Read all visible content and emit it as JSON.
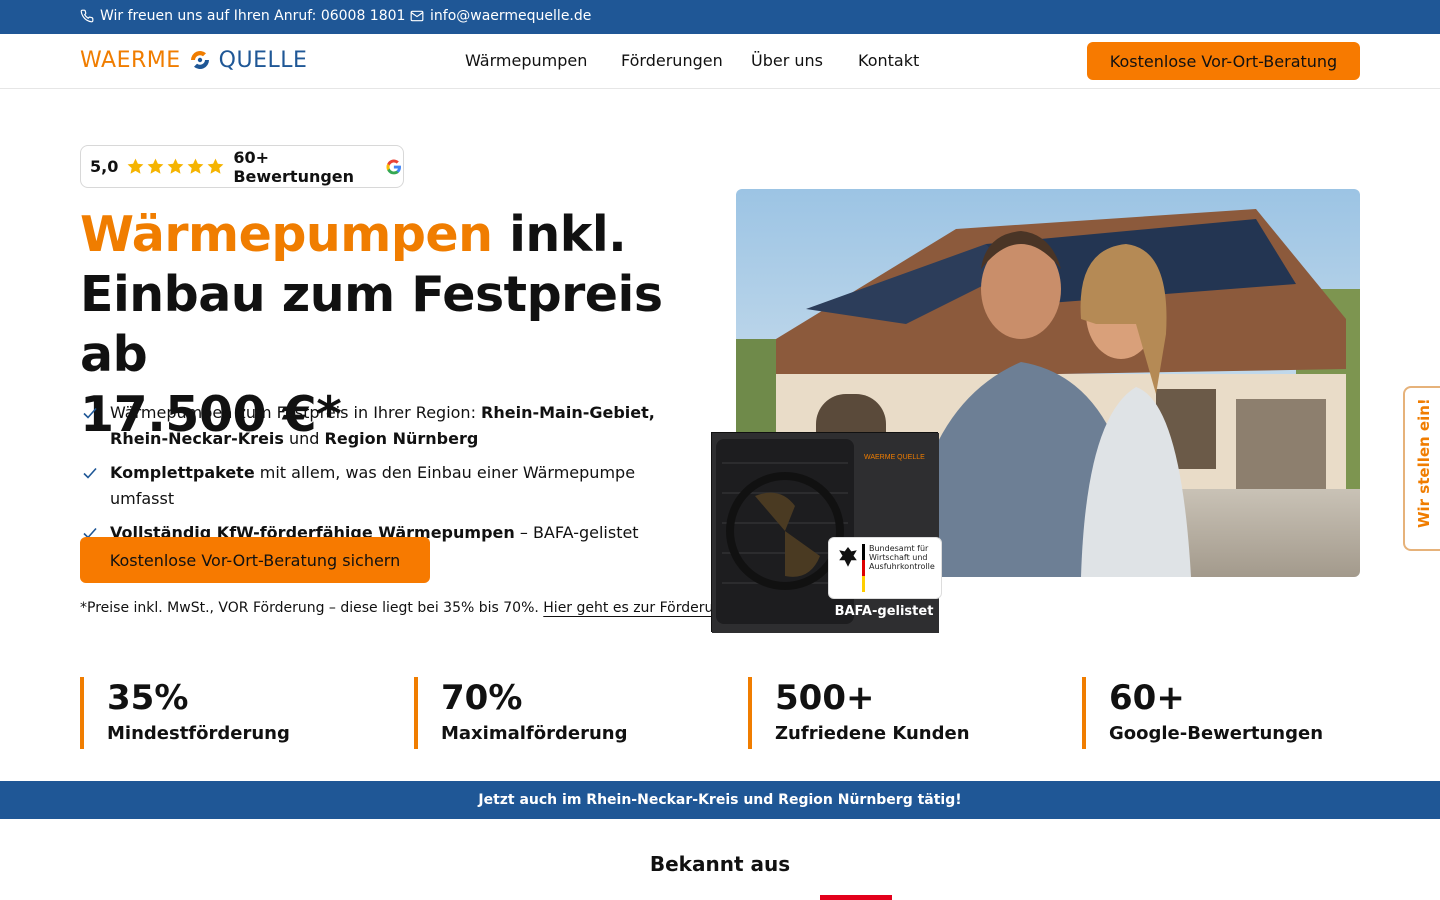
{
  "topbar": {
    "phone_text": "Wir freuen uns auf Ihren Anruf: 06008 1801",
    "email_text": "info@waermequelle.de"
  },
  "nav": {
    "logo_left": "WAERME",
    "logo_right": "QUELLE",
    "items": [
      "Wärmepumpen",
      "Förderungen",
      "Über uns",
      "Kontakt"
    ],
    "cta": "Kostenlose Vor-Ort-Beratung"
  },
  "rating": {
    "score": "5,0",
    "stars": 5,
    "reviews": "60+ Bewertungen"
  },
  "headline": {
    "orange": "Wärmepumpen",
    "rest1": " inkl.",
    "line2": "Einbau zum Festpreis ab",
    "line3": "17.500 €*"
  },
  "checks": [
    {
      "a": "Wärmepumpen zum Festpreis in Ihrer Region: ",
      "b": "Rhein-Main-Gebiet, Rhein-Neckar-Kreis",
      "c": " und ",
      "d": "Region Nürnberg"
    },
    {
      "a": "",
      "b": "Komplettpakete",
      "c": " mit allem, was den Einbau einer Wärmepumpe umfasst",
      "d": ""
    },
    {
      "a": "",
      "b": "Vollständig KfW-förderfähige Wärmepumpen",
      "c": " – BAFA-gelistet",
      "d": ""
    }
  ],
  "cta_main": "Kostenlose Vor-Ort-Beratung sichern",
  "note": {
    "text": "*Preise inkl. MwSt., VOR Förderung – diese liegt bei 35% bis 70%. ",
    "link": "Hier geht es zur Förderung"
  },
  "pump_brand": "WAERME QUELLE",
  "badge": {
    "text": "Bundesamt für Wirtschaft und Ausfuhrkontrolle",
    "label": "BAFA-gelistet"
  },
  "sidetab": "Wir stellen ein!",
  "stats": [
    {
      "num": "35%",
      "label": "Mindestförderung"
    },
    {
      "num": "70%",
      "label": "Maximalförderung"
    },
    {
      "num": "500+",
      "label": "Zufriedene Kunden"
    },
    {
      "num": "60+",
      "label": "Google-Bewertungen"
    }
  ],
  "banner": "Jetzt auch im Rhein-Neckar-Kreis und Region Nürnberg tätig!",
  "known_title": "Bekannt aus",
  "colors": {
    "accent": "#f77a00",
    "brand_blue": "#1f5796"
  }
}
